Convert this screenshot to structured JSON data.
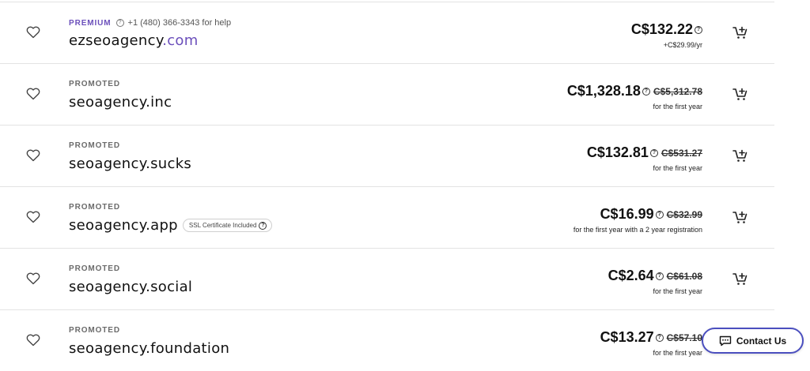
{
  "results": [
    {
      "tag": "PREMIUM",
      "help_text": "+1 (480) 366-3343 for help",
      "domain_name": "ezseoagency",
      "domain_tld": ".com",
      "ssl_text": "",
      "price": "C$132.22",
      "old_price": "",
      "sub_text": "+C$29.99/yr"
    },
    {
      "tag": "PROMOTED",
      "help_text": "",
      "domain_name": "seoagency.inc",
      "domain_tld": "",
      "ssl_text": "",
      "price": "C$1,328.18",
      "old_price": "C$5,312.78",
      "sub_text": "for the first year"
    },
    {
      "tag": "PROMOTED",
      "help_text": "",
      "domain_name": "seoagency.sucks",
      "domain_tld": "",
      "ssl_text": "",
      "price": "C$132.81",
      "old_price": "C$531.27",
      "sub_text": "for the first year"
    },
    {
      "tag": "PROMOTED",
      "help_text": "",
      "domain_name": "seoagency.app",
      "domain_tld": "",
      "ssl_text": "SSL Certificate Included",
      "price": "C$16.99",
      "old_price": "C$32.99",
      "sub_text": "for the first year with a 2 year registration"
    },
    {
      "tag": "PROMOTED",
      "help_text": "",
      "domain_name": "seoagency.social",
      "domain_tld": "",
      "ssl_text": "",
      "price": "C$2.64",
      "old_price": "C$61.08",
      "sub_text": "for the first year"
    },
    {
      "tag": "PROMOTED",
      "help_text": "",
      "domain_name": "seoagency.foundation",
      "domain_tld": "",
      "ssl_text": "",
      "price": "C$13.27",
      "old_price": "C$57.10",
      "sub_text": "for the first year"
    }
  ],
  "contact": {
    "label": "Contact Us",
    "icon": "chat-icon"
  },
  "colors": {
    "premium": "#6b4fbb",
    "tld": "#6b4fbb",
    "contact_border": "#4b4fbf",
    "divider": "#e3e3e3"
  },
  "icons": {
    "favorite": "heart-icon",
    "cart": "add-to-cart-icon",
    "info": "info-icon"
  }
}
